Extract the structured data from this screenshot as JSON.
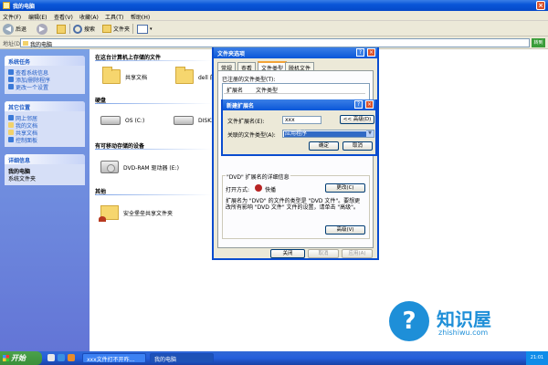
{
  "window": {
    "title": "我的电脑"
  },
  "menubar": {
    "items": [
      "文件(F)",
      "编辑(E)",
      "查看(V)",
      "收藏(A)",
      "工具(T)",
      "帮助(H)"
    ]
  },
  "toolbar": {
    "back": "后退",
    "search": "搜索",
    "folders": "文件夹"
  },
  "address": {
    "label": "地址(D)",
    "value": "我的电脑",
    "go": "转到"
  },
  "leftpane": {
    "system_tasks": {
      "title": "系统任务",
      "links": [
        "查看系统信息",
        "添加/删除程序",
        "更改一个设置"
      ]
    },
    "other_places": {
      "title": "其它位置",
      "links": [
        "网上邻居",
        "我的文档",
        "共享文档",
        "控制面板"
      ]
    },
    "details": {
      "title": "详细信息",
      "name": "我的电脑",
      "desc": "系统文件夹"
    }
  },
  "main": {
    "group_files": "在这台计算机上存储的文件",
    "shared_docs": "共享文档",
    "user_docs": "dell 的文档",
    "group_disks": "硬盘",
    "drive_c": "OS (C:)",
    "drive_d": "DISK2_VO",
    "group_removable": "有可移动存储的设备",
    "dvd": "DVD-RAM 驱动器 (E:)",
    "group_other": "其他",
    "shared_folder": "安全堡垒共享文件夹"
  },
  "folder_options": {
    "title": "文件夹选项",
    "tabs": [
      "常规",
      "查看",
      "文件类型",
      "脱机文件"
    ],
    "registered_label": "已注册的文件类型(T):",
    "col_ext": "扩展名",
    "col_type": "文件类型",
    "details_title": "\"DVD\" 扩展名的详细信息",
    "opens_with_label": "打开方式:",
    "opens_with_value": "快播",
    "change_btn": "更改(C)",
    "desc": "扩展名为 \"DVD\" 的文件的类型是 \"DVD 文件\"。要想更改所有影响 \"DVD 文件\" 文件的设置，请单击 \"高级\"。",
    "advanced_btn": "高级(V)",
    "close_btn": "关闭",
    "cancel_btn": "取消",
    "apply_btn": "应用(A)"
  },
  "new_extension": {
    "title": "新建扩展名",
    "ext_label": "文件扩展名(E):",
    "ext_value": "xxx",
    "advanced_btn": "<< 高级(D)",
    "assoc_label": "关联的文件类型(A):",
    "assoc_value": "应用程序",
    "ok_btn": "确定",
    "cancel_btn": "取消"
  },
  "watermark": {
    "title": "知识屋",
    "url": "zhishiwu.com"
  },
  "taskbar": {
    "start": "开始",
    "tasks": [
      "xxx文件打不开咋...",
      "我的电脑"
    ],
    "clock": "21:01"
  }
}
